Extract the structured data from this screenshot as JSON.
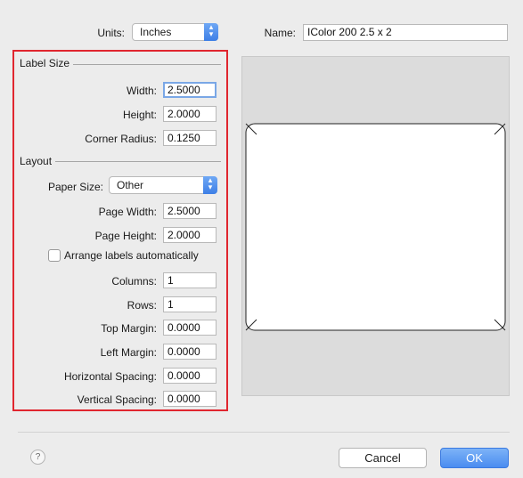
{
  "units": {
    "label": "Units:",
    "value": "Inches"
  },
  "name": {
    "label": "Name:",
    "value": "IColor 200 2.5 x 2"
  },
  "label_size": {
    "title": "Label Size",
    "width": {
      "label": "Width:",
      "value": "2.5000"
    },
    "height": {
      "label": "Height:",
      "value": "2.0000"
    },
    "corner_radius": {
      "label": "Corner Radius:",
      "value": "0.1250"
    }
  },
  "layout": {
    "title": "Layout",
    "paper_size": {
      "label": "Paper Size:",
      "value": "Other"
    },
    "page_width": {
      "label": "Page Width:",
      "value": "2.5000"
    },
    "page_height": {
      "label": "Page Height:",
      "value": "2.0000"
    },
    "arrange_auto": {
      "label": "Arrange labels automatically",
      "checked": false
    },
    "columns": {
      "label": "Columns:",
      "value": "1"
    },
    "rows": {
      "label": "Rows:",
      "value": "1"
    },
    "top_margin": {
      "label": "Top Margin:",
      "value": "0.0000"
    },
    "left_margin": {
      "label": "Left Margin:",
      "value": "0.0000"
    },
    "horizontal_spacing": {
      "label": "Horizontal Spacing:",
      "value": "0.0000"
    },
    "vertical_spacing": {
      "label": "Vertical Spacing:",
      "value": "0.0000"
    }
  },
  "footer": {
    "help": "?",
    "cancel": "Cancel",
    "ok": "OK"
  },
  "colors": {
    "highlight": "#e0262f",
    "accent": "#3d7fe6"
  }
}
